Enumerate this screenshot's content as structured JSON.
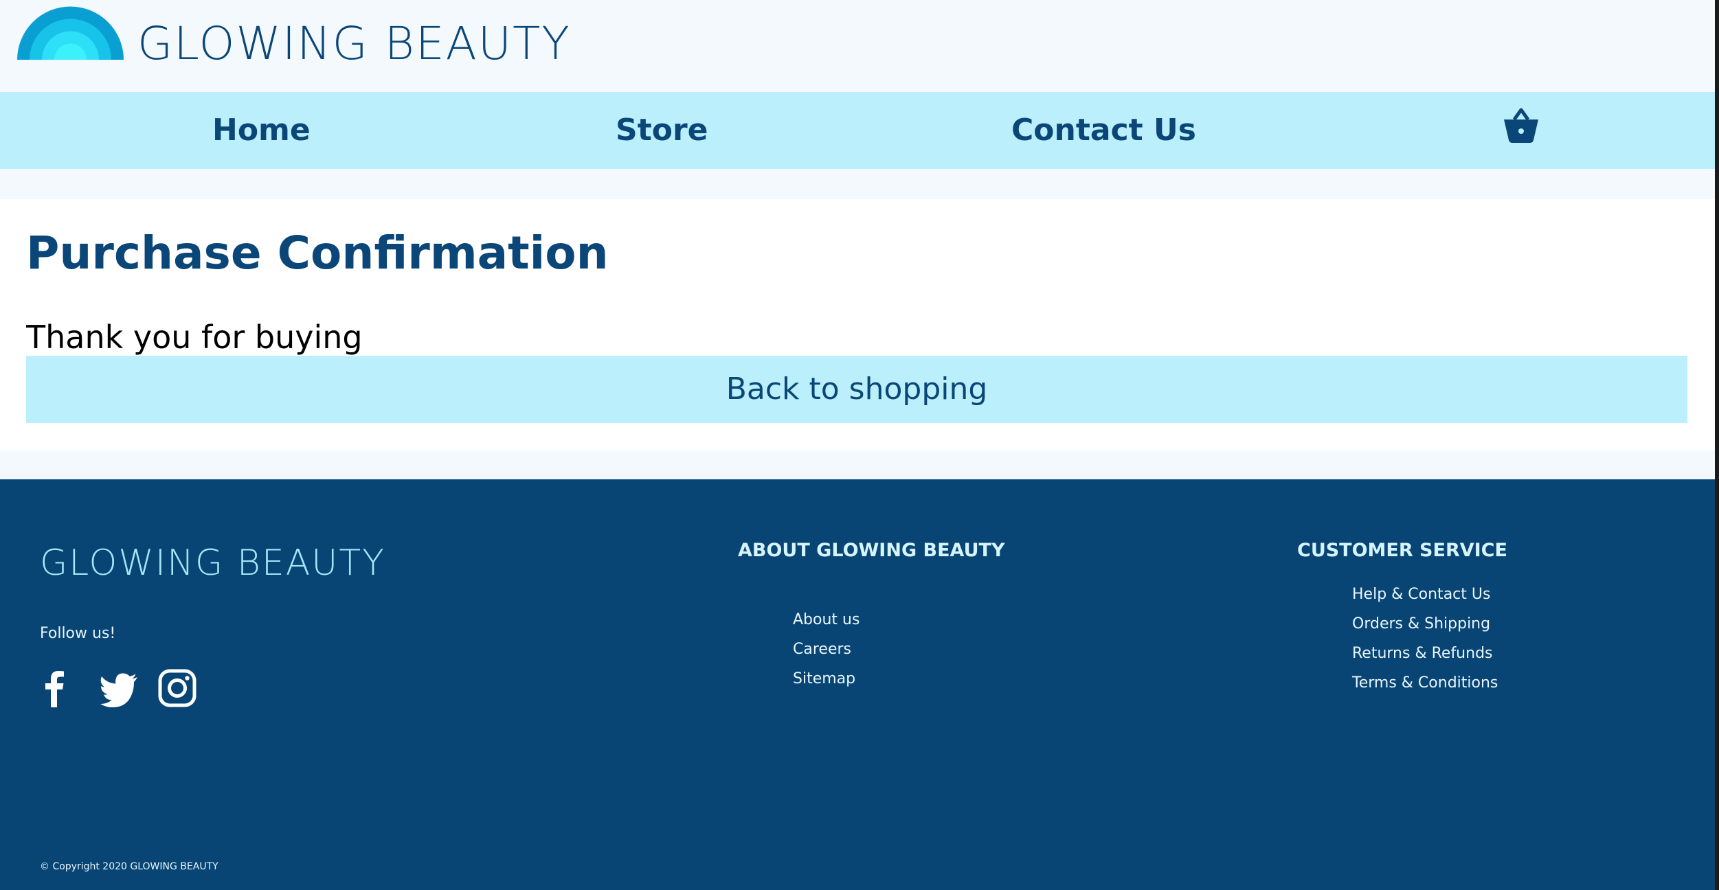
{
  "header": {
    "brand": "GLOWING BEAUTY",
    "logo_icon": "rainbow-arc-logo",
    "colors": {
      "background": "#f3f9fd",
      "text": "#0a4677"
    }
  },
  "nav": {
    "items": [
      {
        "label": "Home"
      },
      {
        "label": "Store"
      },
      {
        "label": "Contact Us"
      }
    ],
    "cart_icon": "basket-icon",
    "colors": {
      "background": "#baeffb",
      "text": "#0a4677"
    }
  },
  "main": {
    "title": "Purchase Confirmation",
    "message": "Thank you for buying",
    "back_button": "Back to shopping"
  },
  "footer": {
    "brand": "GLOWING BEAUTY",
    "follow": "Follow us!",
    "social_icons": [
      "facebook-icon",
      "twitter-icon",
      "instagram-icon"
    ],
    "about": {
      "heading": "ABOUT GLOWING BEAUTY",
      "links": [
        "About us",
        "Careers",
        "Sitemap"
      ]
    },
    "customer_service": {
      "heading": "CUSTOMER SERVICE",
      "links": [
        "Help & Contact Us",
        "Orders & Shipping",
        "Returns & Refunds",
        "Terms & Conditions"
      ]
    },
    "copyright": "© Copyright 2020 GLOWING BEAUTY",
    "colors": {
      "background": "#084575",
      "text": "#e8f6fb",
      "accent": "#a8e5f6"
    }
  }
}
